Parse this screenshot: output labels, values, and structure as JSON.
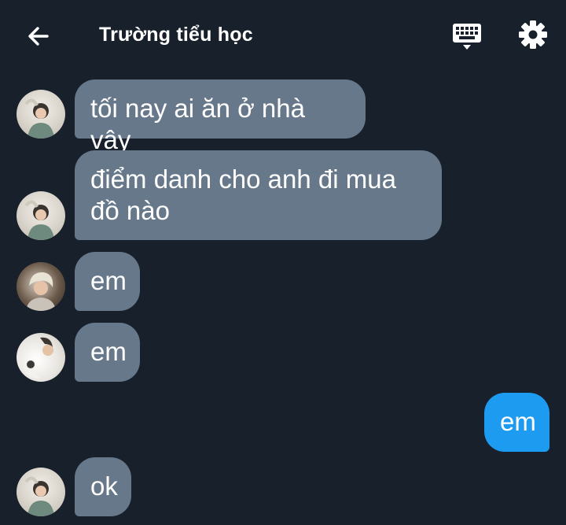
{
  "header": {
    "back_icon": "arrow-left-icon",
    "title": "Trường tiểu học",
    "keyboard_icon": "keyboard-icon",
    "settings_icon": "gear-icon"
  },
  "colors": {
    "background": "#17202b",
    "incoming_bubble": "#66788a",
    "outgoing_bubble": "#1d9bf0"
  },
  "messages": [
    {
      "direction": "incoming",
      "avatar": "avatar-a",
      "lines": [
        "tối nay ai ăn ở nhà vậy"
      ]
    },
    {
      "direction": "incoming",
      "avatar": "avatar-a",
      "lines": [
        "điểm danh cho anh đi mua",
        "đồ nào"
      ]
    },
    {
      "direction": "incoming",
      "avatar": "avatar-b",
      "lines": [
        "em"
      ]
    },
    {
      "direction": "incoming",
      "avatar": "avatar-c",
      "lines": [
        "em"
      ]
    },
    {
      "direction": "outgoing",
      "lines": [
        "em"
      ]
    },
    {
      "direction": "incoming",
      "avatar": "avatar-a",
      "lines": [
        "ok"
      ]
    }
  ]
}
